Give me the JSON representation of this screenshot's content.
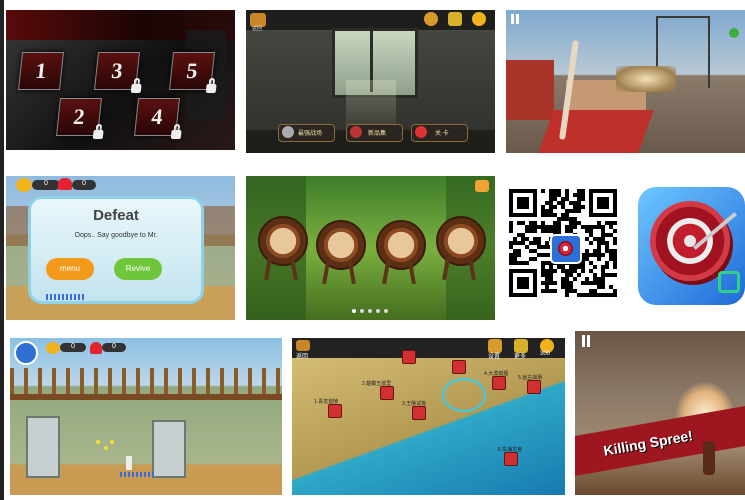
{
  "level_select": {
    "levels": [
      "1",
      "2",
      "3",
      "4",
      "5"
    ]
  },
  "menu_screen": {
    "buttons": [
      "最强战场",
      "新品集",
      "关 卡"
    ],
    "top_left_label": "返回"
  },
  "defeat_dialog": {
    "coins": "0",
    "hearts": "0",
    "title": "Defeat",
    "message": "Oops.. Say goodbye to Mr.",
    "menu_label": "menu",
    "revive_label": "Revive"
  },
  "forest_screen": {
    "page_dots": 5,
    "active_dot": 0
  },
  "hud_room": {
    "coins": "0",
    "hearts": "0"
  },
  "world_map": {
    "back_label": "返回",
    "top_labels": [
      "设置",
      "更多",
      "300"
    ],
    "places": [
      "1.青龙首陵",
      "2.楚霸王故里",
      "3.王陵试炼",
      "4.大漠孤烟",
      "5.远古战场",
      "6.东海龙宫"
    ]
  },
  "killing_spree": {
    "banner": "Killing Spree!"
  },
  "colors": {
    "coin": "#f2b21b",
    "heart": "#e52330",
    "menu_button": "#f39a1a",
    "revive_button": "#6fc63a",
    "node": "#d03030"
  }
}
